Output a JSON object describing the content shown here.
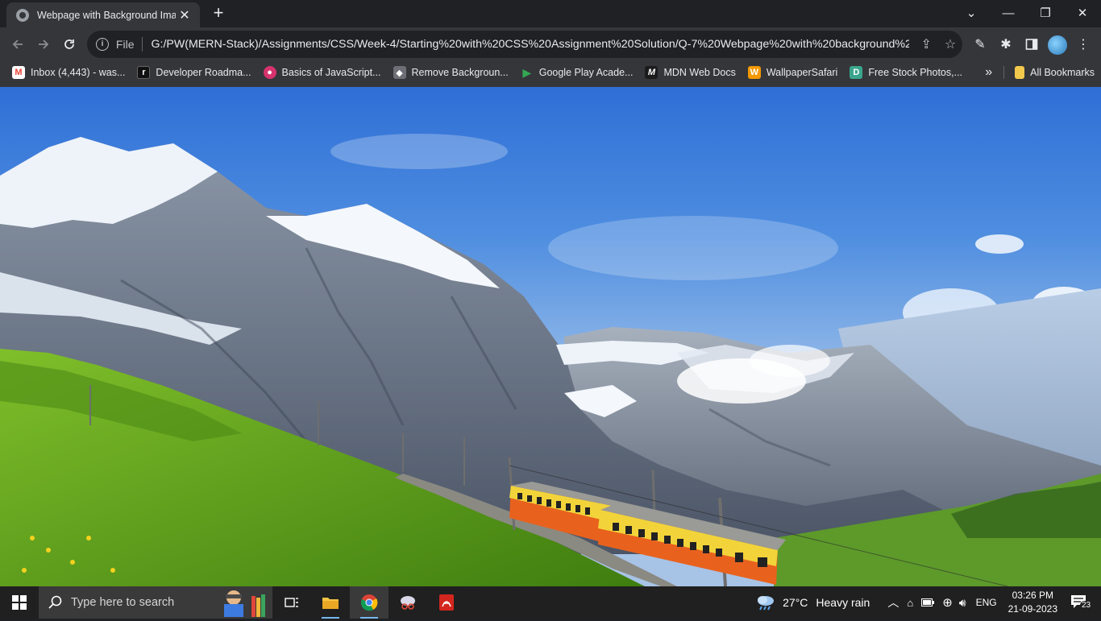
{
  "browser": {
    "tab": {
      "title": "Webpage with Background Image",
      "close": "✕"
    },
    "new_tab": "+",
    "window_controls": {
      "minimize": "—",
      "restore": "❐",
      "close": "✕",
      "tab_search": "⌄"
    },
    "address_bar": {
      "scheme": "File",
      "url": "G:/PW(MERN-Stack)/Assignments/CSS/Week-4/Starting%20with%20CSS%20Assignment%20Solution/Q-7%20Webpage%20with%20background%20im..."
    },
    "bookmarks": [
      {
        "label": "Inbox (4,443) - was...",
        "icon": "gmail-icon",
        "color": "#ea4335",
        "glyph": "M"
      },
      {
        "label": "Developer Roadma...",
        "icon": "roadmap-icon",
        "color": "#111111",
        "glyph": "r"
      },
      {
        "label": "Basics of JavaScript...",
        "icon": "javascript-icon",
        "color": "#d6336c",
        "glyph": "●"
      },
      {
        "label": "Remove Backgroun...",
        "icon": "removebg-icon",
        "color": "#6c7076",
        "glyph": "◆"
      },
      {
        "label": "Google Play Acade...",
        "icon": "google-play-icon",
        "color": "#34a853",
        "glyph": "▶"
      },
      {
        "label": "MDN Web Docs",
        "icon": "mdn-icon",
        "color": "#1b1b1b",
        "glyph": "M"
      },
      {
        "label": "WallpaperSafari",
        "icon": "wallpapersafari-icon",
        "color": "#f29900",
        "glyph": "W"
      },
      {
        "label": "Free Stock Photos,...",
        "icon": "stock-photos-icon",
        "color": "#3aa58c",
        "glyph": "D"
      }
    ],
    "bookmarks_overflow": "»",
    "all_bookmarks": "All Bookmarks"
  },
  "taskbar": {
    "search_placeholder": "Type here to search",
    "weather": {
      "temp": "27°C",
      "condition": "Heavy rain"
    },
    "language": "ENG",
    "time": "03:26 PM",
    "date": "21-09-2023",
    "notifications": "23"
  }
}
